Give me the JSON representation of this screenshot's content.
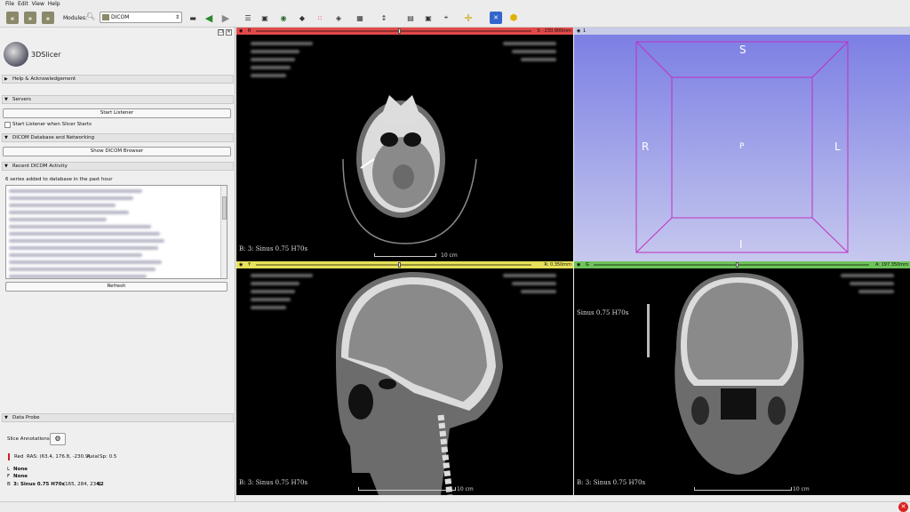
{
  "menu": [
    "File",
    "Edit",
    "View",
    "Help"
  ],
  "toolbar": {
    "modules_label": "Modules:",
    "module_selected": "DICOM",
    "icons": [
      "dicom-load-icon",
      "dicom-data-icon",
      "save-icon",
      "search-icon",
      "back-icon",
      "forward-icon",
      "python-icon"
    ]
  },
  "panel": {
    "app_name": "3DSlicer",
    "help_section": "Help & Acknowledgement",
    "servers_section": "Servers",
    "start_listener": "Start Listener",
    "start_listener_check": "Start Listener when Slicer Starts",
    "dicom_db_section": "DICOM Database and Networking",
    "show_browser": "Show DICOM Browser",
    "recent_section": "Recent DICOM Activity",
    "recent_summary": "6 series added to database in the past hour",
    "refresh": "Refresh",
    "data_probe_section": "Data Probe",
    "slice_annotations": "Slice Annotations:",
    "probe_view": "Red",
    "probe_ras": "RAS: (63.4, 176.8, -230.9)",
    "probe_orient": "Axial",
    "probe_sp": "Sp: 0.5",
    "probe_l_key": "L",
    "probe_l_val": "None",
    "probe_f_key": "F",
    "probe_f_val": "None",
    "probe_b_key": "B",
    "probe_b_val": "3: Sinus 0.75 H70s",
    "probe_b_ijk": "(165, 284, 234)",
    "probe_b_num": "62"
  },
  "views": {
    "red": {
      "pin": "R",
      "offset": "S: -230.900mm",
      "label": "B: 3: Sinus  0.75  H70s",
      "scale": "10 cm"
    },
    "view3d": {
      "pin": "1",
      "orient": {
        "top": "S",
        "bottom": "I",
        "left": "R",
        "right": "L",
        "center": "P"
      }
    },
    "yellow": {
      "pin": "Y",
      "offset": "R: 0.350mm",
      "label": "B: 3: Sinus  0.75  H70s",
      "scale": "10 cm"
    },
    "green": {
      "pin": "G",
      "offset": "A: 197.350mm",
      "label": "B: 3: Sinus  0.75  H70s",
      "label_top": "Sinus  0.75  H70s",
      "scale": "10 cm"
    }
  },
  "colors": {
    "red": "#e73434",
    "yellow": "#e6e15a",
    "green": "#6ec35a",
    "box3d": "#c030c0"
  }
}
